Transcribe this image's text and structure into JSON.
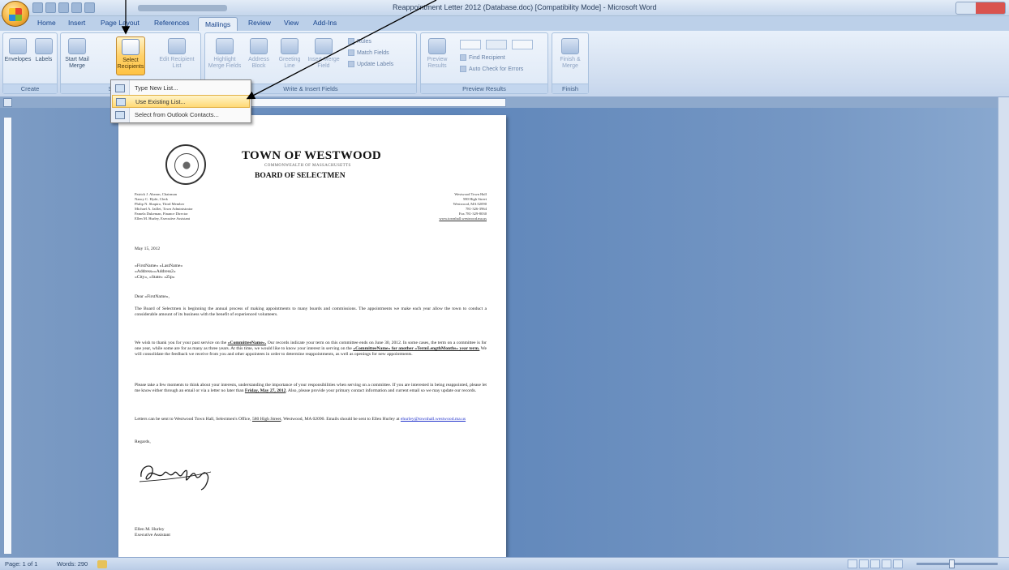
{
  "window": {
    "title": "Reappointment Letter 2012 (Database.doc) [Compatibility Mode] - Microsoft Word"
  },
  "tabs": [
    "Home",
    "Insert",
    "Page Layout",
    "References",
    "Mailings",
    "Review",
    "View",
    "Add-Ins"
  ],
  "active_tab": "Mailings",
  "ribbon": {
    "groups": {
      "create": "Create",
      "start_mail_merge": "Start Mail Merge",
      "write_insert_fields": "Write & Insert Fields",
      "preview_results": "Preview Results",
      "finish": "Finish"
    },
    "buttons": {
      "envelopes": "Envelopes",
      "labels": "Labels",
      "start_mail_merge": "Start Mail Merge",
      "select_recipients": "Select Recipients",
      "edit_recipient_list": "Edit Recipient List",
      "highlight_merge_fields": "Highlight Merge Fields",
      "address_block": "Address Block",
      "greeting_line": "Greeting Line",
      "insert_merge_field": "Insert Merge Field",
      "rules": "Rules",
      "match_fields": "Match Fields",
      "update_labels": "Update Labels",
      "preview_results": "Preview Results",
      "find_recipient": "Find Recipient",
      "auto_check_for_errors": "Auto Check for Errors",
      "finish_merge": "Finish & Merge"
    }
  },
  "dropdown": {
    "items": [
      {
        "label": "Type New List...",
        "selected": false
      },
      {
        "label": "Use Existing List...",
        "selected": true
      },
      {
        "label": "Select from Outlook Contacts...",
        "selected": false
      }
    ]
  },
  "document": {
    "header": {
      "town": "TOWN OF WESTWOOD",
      "commonwealth": "COMMONWEALTH OF MASSACHUSETTS",
      "board": "BOARD OF SELECTMEN"
    },
    "officials": [
      "Patrick J. Ahearn, Chairman",
      "Nancy C. Hyde, Clerk",
      "Philip N. Shapiro, Third Member",
      "Michael A. Jaillet, Town Administrator",
      "Pamela Dukeman, Finance Director",
      "Ellen M. Hurley, Executive Assistant"
    ],
    "address": [
      "Westwood Town Hall",
      "580 High Street",
      "Westwood, MA 02090",
      "781-326-3964",
      "Fax 781-329-8030",
      "www.townhall.westwood.ma.us"
    ],
    "date": "May 15, 2012",
    "merge_lines": [
      "«FirstName» «LastName»",
      "«Address»«Address2»",
      "«City», «State» «Zip»"
    ],
    "salutation": "Dear «FirstName»,",
    "p1": "The Board of Selectmen is beginning the annual process of making appointments to many boards and commissions. The appointments we make each year allow the town to conduct a considerable amount of its business with the benefit of experienced volunteers.",
    "p2_a": "We wish to thank you for your past service on the ",
    "p2_field": "«CommitteeName».",
    "p2_b": " Our records indicate your term on this committee ends on June 30, 2012. In some cases, the term on a committee is for one year, while some are for as many as three years. At this time, we would like to know your interest in serving on the ",
    "p2_field2": "«CommitteeName» for another «TermLengthMonths» year term.",
    "p2_c": " We will consolidate the feedback we receive from you and other appointees in order to determine reappointments, as well as openings for new appointments.",
    "p3_a": "Please take a few moments to think about your interests, understanding the importance of your responsibilities when serving on a committee. If you are interested in being reappointed, please let me know either through an email or via a letter no later than ",
    "p3_deadline": "Friday, May 27, 2012",
    "p3_b": ". Also, please provide your primary contact information and current email so we may update our records.",
    "p4_a": "Letters can be sent to Westwood Town Hall, Selectmen's Office, ",
    "p4_street": "580 High Street",
    "p4_b": ", Westwood, MA 02090. Emails should be sent to Ellen Hurley at ",
    "p4_email": "ehurley@townhall.westwood.ma.us",
    "regards": "Regards,",
    "signer_name": "Ellen M. Hurley",
    "signer_title": "Executive Assistant"
  },
  "status": {
    "page": "Page: 1 of 1",
    "words": "Words: 290"
  },
  "colors": {
    "ribbon_highlight": "#ffc343",
    "menu_selected": "#ffd975",
    "workspace": "#6d90bf"
  }
}
